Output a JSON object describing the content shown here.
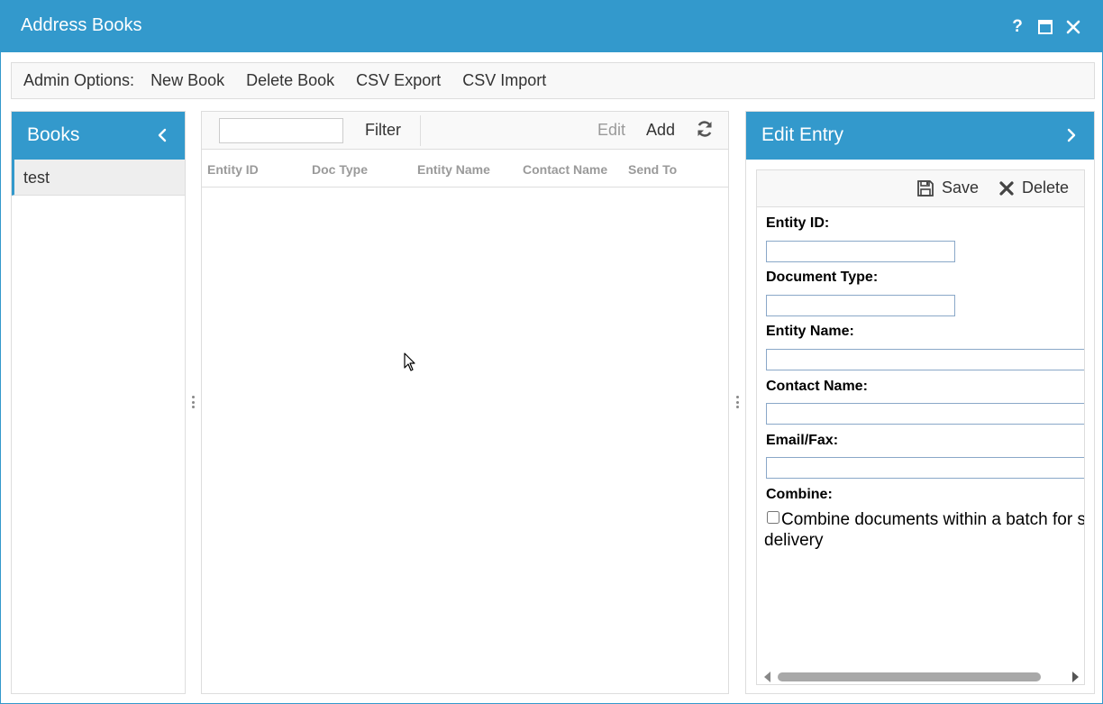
{
  "window": {
    "title": "Address Books",
    "help_icon": "help-icon",
    "maximize_icon": "maximize-icon",
    "close_icon": "close-icon"
  },
  "toolbar": {
    "label": "Admin Options:",
    "items": [
      "New Book",
      "Delete Book",
      "CSV Export",
      "CSV Import"
    ]
  },
  "books": {
    "title": "Books",
    "collapse_icon": "chevron-left-icon",
    "items": [
      "test"
    ]
  },
  "grid": {
    "filter_value": "",
    "filter_label": "Filter",
    "edit_label": "Edit",
    "add_label": "Add",
    "refresh_icon": "refresh-icon",
    "columns": [
      "Entity ID",
      "Doc Type",
      "Entity Name",
      "Contact Name",
      "Send To"
    ],
    "rows": []
  },
  "edit_entry": {
    "title": "Edit Entry",
    "expand_icon": "chevron-right-icon",
    "save_label": "Save",
    "delete_label": "Delete",
    "fields": {
      "entity_id_label": "Entity ID:",
      "entity_id_value": "",
      "document_type_label": "Document Type:",
      "document_type_value": "",
      "entity_name_label": "Entity Name:",
      "entity_name_value": "",
      "contact_name_label": "Contact Name:",
      "contact_name_value": "",
      "email_fax_label": "Email/Fax:",
      "email_fax_value": "",
      "combine_label": "Combine:",
      "combine_text": "Combine documents within a batch for single delivery",
      "combine_checked": false
    }
  },
  "colors": {
    "accent": "#3399cc",
    "border": "#dddddd",
    "muted_text": "#9a9a9a"
  }
}
